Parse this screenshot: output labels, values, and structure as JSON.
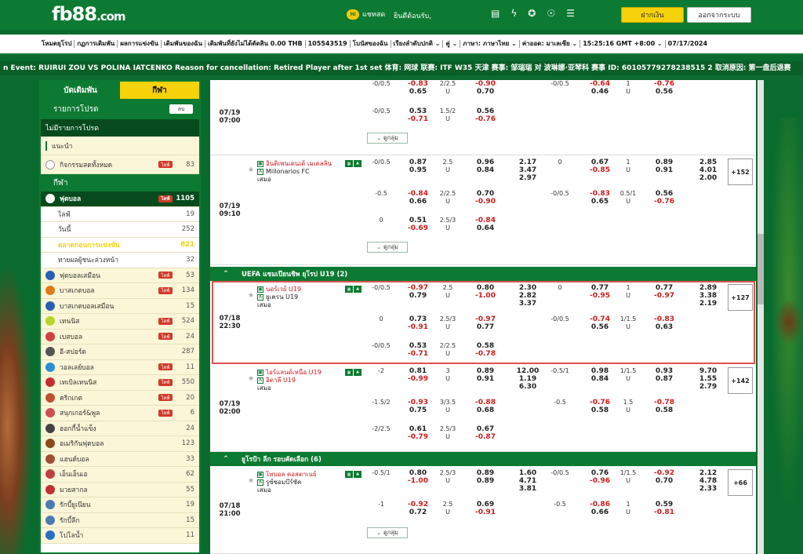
{
  "header": {
    "logo_main": "fb88",
    "logo_suffix": ".com",
    "chat_badge": "Hi",
    "chat_label": "แชทสด",
    "welcome": "ยินดีต้อนรับ,",
    "deposit": "ฝากเงิน",
    "logout": "ออกจากระบบ"
  },
  "menubar": [
    "โหมดยุโรป",
    "กฏการเดิมพัน",
    "ผลการแข่งขัน",
    "เดิมพันของฉัน",
    "เดิมพันที่ยังไม่ได้ตัดสิน 0.00 THB",
    "105543519",
    "โบนัสของฉัน",
    "เรียงลำดับปกติ ⌄",
    "คู่ ⌄",
    "ภาษา: ภาษาไทย ⌄",
    "ค่าออด: มาเลเซีย ⌄",
    "15:25:16 GMT +8:00 ⌄",
    "07/17/2024"
  ],
  "ticker": "n Event: RUIRUI ZOU VS POLINA IATCENKO Reason for cancellation: Retired Player after 1st set 体育: 网球 联赛: ITF W35 天津 赛事: 邹瑞瑞 对 波琳娜·亚琴科 赛事 ID: 60105779278238515 2 取消原因: 第一盘后退赛",
  "sidebar": {
    "tab_bet": "บัดเดิมพัน",
    "tab_sport": "กีฬา",
    "my_list": "รายการโปรด",
    "my_list_btn": "ลบ",
    "no_fav": "ไม่มีรายการโปรด",
    "recommend": "แนะนำ",
    "all_live": "กิจกรรมสดทั้งหมด",
    "all_live_count": "83",
    "sports_title": "กีฬา",
    "live_badge": "ไลฟ์",
    "football": {
      "label": "ฟุตบอล",
      "count": "1105"
    },
    "subs": [
      {
        "label": "ไลฟ์",
        "count": "19"
      },
      {
        "label": "วันนี้",
        "count": "252"
      },
      {
        "label": "ตลาดก่อนการแข่งขัน",
        "count": "821"
      },
      {
        "label": "ทายผลผู้ชนะล่วงหน้า",
        "count": "32"
      }
    ],
    "sports": [
      {
        "label": "ฟุตบอลเสมือน",
        "count": "53",
        "live": true,
        "color": "#2a5fb0"
      },
      {
        "label": "บาสเกตบอล",
        "count": "134",
        "live": true,
        "color": "#e07a1a"
      },
      {
        "label": "บาสเกตบอลเสมือน",
        "count": "15",
        "live": false,
        "color": "#2a5fb0"
      },
      {
        "label": "เทนนิส",
        "count": "524",
        "live": true,
        "color": "#b8d42a"
      },
      {
        "label": "เบสบอล",
        "count": "24",
        "live": true,
        "color": "#d04040"
      },
      {
        "label": "อี-สปอร์ต",
        "count": "287",
        "live": false,
        "color": "#555555"
      },
      {
        "label": "วอลเลย์บอล",
        "count": "11",
        "live": true,
        "color": "#2a8fd0"
      },
      {
        "label": "เทเบิลเทนนิส",
        "count": "550",
        "live": true,
        "color": "#c03030"
      },
      {
        "label": "คริกเกต",
        "count": "20",
        "live": true,
        "color": "#c05030"
      },
      {
        "label": "สนุกเกอร์&พูล",
        "count": "6",
        "live": true,
        "color": "#d05050"
      },
      {
        "label": "ฮอกกี้น้ำแข็ง",
        "count": "24",
        "live": false,
        "color": "#444444"
      },
      {
        "label": "อเมริกันฟุตบอล",
        "count": "123",
        "live": false,
        "color": "#8a4a1a"
      },
      {
        "label": "แฮนด์บอล",
        "count": "33",
        "live": false,
        "color": "#a05030"
      },
      {
        "label": "เอ็นเอ็นเอ",
        "count": "62",
        "live": false,
        "color": "#c04040"
      },
      {
        "label": "มวยสากล",
        "count": "55",
        "live": false,
        "color": "#c03030"
      },
      {
        "label": "รักบี้ยูเนียน",
        "count": "19",
        "live": false,
        "color": "#4a7ab0"
      },
      {
        "label": "รักบี้ลีก",
        "count": "15",
        "live": false,
        "color": "#4a7ab0"
      },
      {
        "label": "โปโลน้ำ",
        "count": "11",
        "live": false,
        "color": "#2a6fc0"
      }
    ]
  },
  "main": {
    "expand_label": "ดูกลุ่ม",
    "leagues": [
      "UEFA แชมเปียนชิพ ยุโรป U19 (2)",
      "ยูโรป้า ลีก รอบคัดเลือก (6)"
    ],
    "matches": [
      {
        "date": "07/19",
        "time": "07:00",
        "rows": [
          {
            "hdp": "-0/0.5",
            "h1": "-0.83",
            "h2": "0.65",
            "ou": "2/2.5",
            "ouu": "U",
            "o1": "-0.90",
            "o2": "0.70",
            "fh": "-0/0.5",
            "fh1": "-0.64",
            "fh2": "0.46",
            "fou": "1",
            "fouu": "U",
            "fo1": "-0.76",
            "fo2": "0.56"
          },
          {
            "hdp": "-0/0.5",
            "h1": "0.53",
            "h2": "-0.71",
            "ou": "1.5/2",
            "ouu": "U",
            "o1": "0.56",
            "o2": "-0.76"
          }
        ]
      },
      {
        "date": "07/19",
        "time": "09:10",
        "home": "อินดิเพนเดนเต้ เมเดลลิน",
        "away": "Millonarios FC",
        "draw": "เสมอ",
        "x12": [
          "2.17",
          "3.47",
          "2.97"
        ],
        "fx12": [
          "2.85",
          "4.01",
          "2.00"
        ],
        "more": "+152",
        "rows": [
          {
            "hdp": "-0/0.5",
            "h1": "0.87",
            "h2": "0.95",
            "ou": "2.5",
            "ouu": "U",
            "o1": "0.96",
            "o2": "0.84",
            "fh": "0",
            "fh1": "0.67",
            "fh2": "-0.85",
            "fou": "1",
            "fouu": "U",
            "fo1": "0.89",
            "fo2": "0.91"
          },
          {
            "hdp": "-0.5",
            "h1": "-0.84",
            "h2": "0.66",
            "ou": "2/2.5",
            "ouu": "U",
            "o1": "0.70",
            "o2": "-0.90",
            "fh": "-0/0.5",
            "fh1": "-0.83",
            "fh2": "0.65",
            "fou": "0.5/1",
            "fouu": "U",
            "fo1": "0.56",
            "fo2": "-0.76"
          },
          {
            "hdp": "0",
            "h1": "0.51",
            "h2": "-0.69",
            "ou": "2.5/3",
            "ouu": "U",
            "o1": "-0.84",
            "o2": "0.64"
          }
        ]
      },
      {
        "date": "07/18",
        "time": "22:30",
        "home": "นอร์เวย์ U19",
        "away": "ยูเครน U19",
        "draw": "เสมอ",
        "x12": [
          "2.30",
          "2.82",
          "3.37"
        ],
        "fx12": [
          "2.89",
          "3.38",
          "2.19"
        ],
        "more": "+127",
        "rows": [
          {
            "hdp": "-0/0.5",
            "h1": "-0.97",
            "h2": "0.79",
            "ou": "2.5",
            "ouu": "U",
            "o1": "0.80",
            "o2": "-1.00",
            "fh": "0",
            "fh1": "0.77",
            "fh2": "-0.95",
            "fou": "1",
            "fouu": "U",
            "fo1": "0.77",
            "fo2": "-0.97"
          },
          {
            "hdp": "0",
            "h1": "0.73",
            "h2": "-0.91",
            "ou": "2.5/3",
            "ouu": "U",
            "o1": "-0.97",
            "o2": "0.77",
            "fh": "-0/0.5",
            "fh1": "-0.74",
            "fh2": "0.56",
            "fou": "1/1.5",
            "fouu": "U",
            "fo1": "-0.83",
            "fo2": "0.63"
          },
          {
            "hdp": "-0/0.5",
            "h1": "0.53",
            "h2": "-0.71",
            "ou": "2/2.5",
            "ouu": "U",
            "o1": "0.58",
            "o2": "-0.78"
          }
        ]
      },
      {
        "date": "07/19",
        "time": "02:00",
        "home": "ไอร์แลนด์เหนือ U19",
        "away": "อิตาลี U19",
        "draw": "เสมอ",
        "x12": [
          "12.00",
          "1.19",
          "6.30"
        ],
        "fx12": [
          "9.70",
          "1.55",
          "2.79"
        ],
        "more": "+142",
        "rows": [
          {
            "hdp": "-2",
            "h1": "0.81",
            "h2": "-0.99",
            "ou": "3",
            "ouu": "U",
            "o1": "0.89",
            "o2": "0.91",
            "fh": "-0.5/1",
            "fh1": "0.98",
            "fh2": "0.84",
            "fou": "1/1.5",
            "fouu": "U",
            "fo1": "0.93",
            "fo2": "0.87"
          },
          {
            "hdp": "-1.5/2",
            "h1": "-0.93",
            "h2": "0.75",
            "ou": "3/3.5",
            "ouu": "U",
            "o1": "-0.88",
            "o2": "0.68",
            "fh": "-0.5",
            "fh1": "-0.76",
            "fh2": "0.58",
            "fou": "1.5",
            "fouu": "U",
            "fo1": "-0.78",
            "fo2": "0.58"
          },
          {
            "hdp": "-2/2.5",
            "h1": "0.61",
            "h2": "-0.79",
            "ou": "2.5/3",
            "ouu": "U",
            "o1": "0.67",
            "o2": "-0.87"
          }
        ]
      },
      {
        "date": "07/18",
        "time": "21:00",
        "home": "โทบอล คอสตาเนย์",
        "away": "รูซ์ซอมบีร์ซัค",
        "draw": "เสมอ",
        "x12": [
          "1.60",
          "4.71",
          "3.81"
        ],
        "fx12": [
          "2.12",
          "4.78",
          "2.33"
        ],
        "more": "+66",
        "rows": [
          {
            "hdp": "-0.5/1",
            "h1": "0.80",
            "h2": "-1.00",
            "ou": "2.5/3",
            "ouu": "U",
            "o1": "0.89",
            "o2": "0.89",
            "fh": "-0/0.5",
            "fh1": "0.76",
            "fh2": "-0.96",
            "fou": "1/1.5",
            "fouu": "U",
            "fo1": "-0.92",
            "fo2": "0.70"
          },
          {
            "hdp": "-1",
            "h1": "-0.92",
            "h2": "0.72",
            "ou": "2.5",
            "ouu": "U",
            "o1": "0.69",
            "o2": "-0.91",
            "fh": "-0.5",
            "fh1": "-0.86",
            "fh2": "0.66",
            "fou": "1",
            "fouu": "U",
            "fo1": "0.59",
            "fo2": "-0.81"
          }
        ]
      }
    ]
  },
  "colors": {
    "brand_green": "#0c7a32",
    "accent_yellow": "#f5d20a",
    "negative_red": "#d01a1a"
  }
}
